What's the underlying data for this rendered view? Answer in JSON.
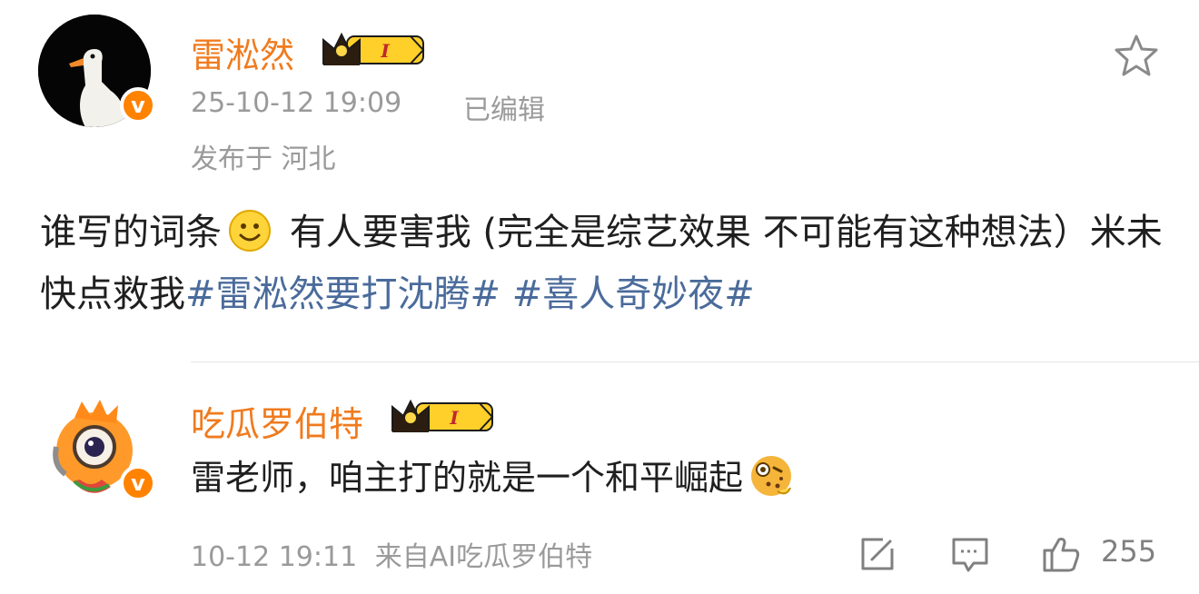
{
  "post": {
    "author": "雷淞然",
    "level_badge": "I",
    "timestamp": "25-10-12 19:09",
    "edited_label": "已编辑",
    "location": "发布于 河北",
    "text_part1": "谁写的词条",
    "text_part2": " 有人要害我 (完全是综艺效果 不可能有这种想法）米未快点救我",
    "hashtag1": "#雷淞然要打沈腾#",
    "hashtag2": " #喜人奇妙夜#",
    "favorite_icon": "star-outline-icon"
  },
  "reply": {
    "author": "吃瓜罗伯特",
    "level_badge": "I",
    "text": "雷老师，咱主打的就是一个和平崛起",
    "timestamp": "10-12 19:11",
    "source": "来自AI吃瓜罗伯特",
    "like_count": "255",
    "icons": [
      "edit-icon",
      "comment-icon",
      "thumbs-up-icon"
    ]
  },
  "colors": {
    "username": "#f07b1e",
    "hashtag": "#4a6b9b",
    "verified_badge": "#ff8200",
    "meta_text": "#9a9a9a"
  }
}
